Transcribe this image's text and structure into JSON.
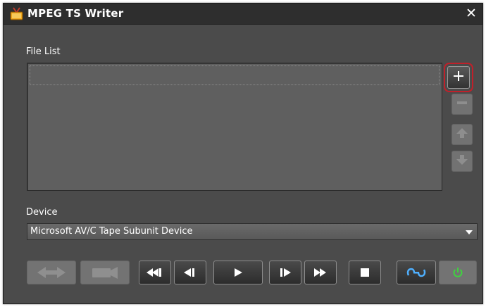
{
  "window": {
    "title": "MPEG TS Writer",
    "close_glyph": "✕"
  },
  "file_list": {
    "label": "File List",
    "items": []
  },
  "device": {
    "label": "Device",
    "selected": "Microsoft AV/C Tape Subunit Device"
  },
  "colors": {
    "window_bg": "#4b4b4b",
    "titlebar_bg": "#2e2e2e",
    "highlight": "#c0202a",
    "power_green": "#3fd23f"
  },
  "icons": {
    "add": "plus-icon",
    "remove": "minus-icon",
    "move_up": "arrow-up-icon",
    "move_down": "arrow-down-icon",
    "fast_rewind": "fast-rewind-icon",
    "frame_back": "frame-back-icon",
    "play": "play-icon",
    "frame_forward": "frame-forward-icon",
    "fast_forward": "fast-forward-icon",
    "stop": "stop-icon",
    "settings": "connection-settings-icon",
    "power": "power-icon"
  }
}
